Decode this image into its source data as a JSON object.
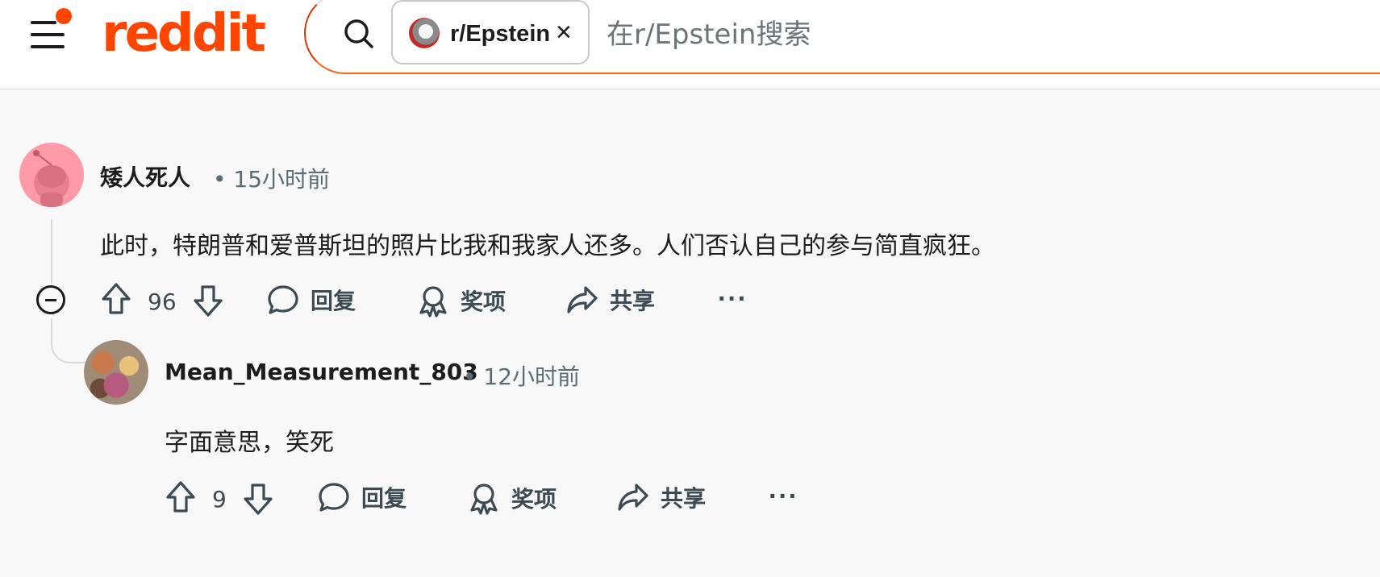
{
  "header": {
    "logo_text": "reddit",
    "brand_color": "#ff4500",
    "search": {
      "community_chip": "r/Epstein",
      "placeholder": "在r/Epstein搜索"
    }
  },
  "comments": [
    {
      "author": "矮人死人",
      "time": "• 15小时前",
      "body": "此时，特朗普和爱普斯坦的照片比我和我家人还多。人们否认自己的参与简直疯狂。",
      "votes": "96",
      "reply_label": "回复",
      "award_label": "奖项",
      "share_label": "共享",
      "more_label": "···"
    },
    {
      "author": "Mean_Measurement_803",
      "time": "• 12小时前",
      "body": "字面意思，笑死",
      "votes": "9",
      "reply_label": "回复",
      "award_label": "奖项",
      "share_label": "共享",
      "more_label": "···"
    }
  ]
}
